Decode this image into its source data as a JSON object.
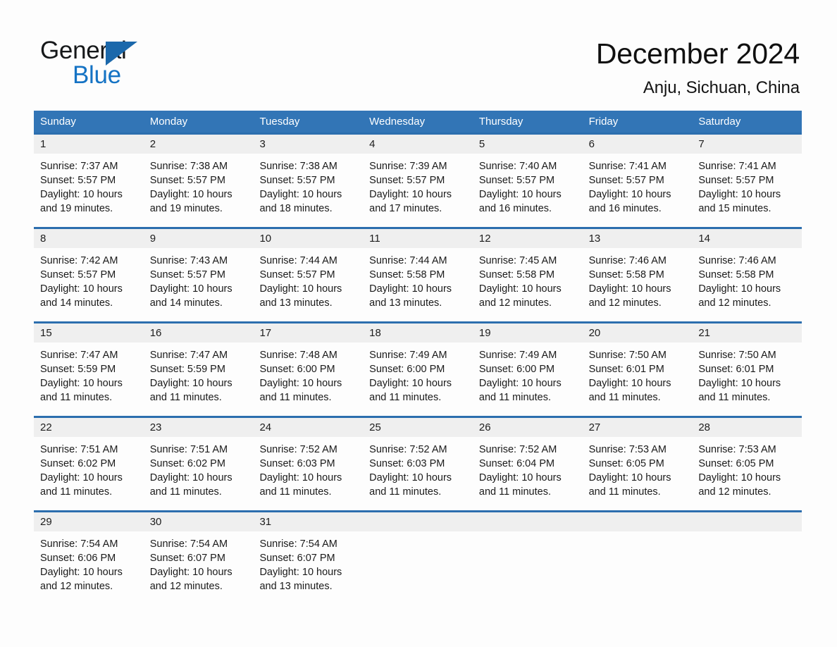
{
  "brand": {
    "logo_text_top": "General",
    "logo_text_bottom": "Blue",
    "logo_black": "#16181a",
    "logo_blue": "#1573c4",
    "triangle_blue": "#1b68ab"
  },
  "header": {
    "title": "December 2024",
    "subtitle": "Anju, Sichuan, China"
  },
  "theme": {
    "header_band": "#3275b6",
    "week_rule": "#2c6eae",
    "daynum_band": "#efefef",
    "page_bg": "#fdfdfd",
    "text": "#1a1a1a"
  },
  "weekdays": [
    "Sunday",
    "Monday",
    "Tuesday",
    "Wednesday",
    "Thursday",
    "Friday",
    "Saturday"
  ],
  "weeks": [
    [
      {
        "day": "1",
        "sunrise": "Sunrise: 7:37 AM",
        "sunset": "Sunset: 5:57 PM",
        "daylight": "Daylight: 10 hours and 19 minutes."
      },
      {
        "day": "2",
        "sunrise": "Sunrise: 7:38 AM",
        "sunset": "Sunset: 5:57 PM",
        "daylight": "Daylight: 10 hours and 19 minutes."
      },
      {
        "day": "3",
        "sunrise": "Sunrise: 7:38 AM",
        "sunset": "Sunset: 5:57 PM",
        "daylight": "Daylight: 10 hours and 18 minutes."
      },
      {
        "day": "4",
        "sunrise": "Sunrise: 7:39 AM",
        "sunset": "Sunset: 5:57 PM",
        "daylight": "Daylight: 10 hours and 17 minutes."
      },
      {
        "day": "5",
        "sunrise": "Sunrise: 7:40 AM",
        "sunset": "Sunset: 5:57 PM",
        "daylight": "Daylight: 10 hours and 16 minutes."
      },
      {
        "day": "6",
        "sunrise": "Sunrise: 7:41 AM",
        "sunset": "Sunset: 5:57 PM",
        "daylight": "Daylight: 10 hours and 16 minutes."
      },
      {
        "day": "7",
        "sunrise": "Sunrise: 7:41 AM",
        "sunset": "Sunset: 5:57 PM",
        "daylight": "Daylight: 10 hours and 15 minutes."
      }
    ],
    [
      {
        "day": "8",
        "sunrise": "Sunrise: 7:42 AM",
        "sunset": "Sunset: 5:57 PM",
        "daylight": "Daylight: 10 hours and 14 minutes."
      },
      {
        "day": "9",
        "sunrise": "Sunrise: 7:43 AM",
        "sunset": "Sunset: 5:57 PM",
        "daylight": "Daylight: 10 hours and 14 minutes."
      },
      {
        "day": "10",
        "sunrise": "Sunrise: 7:44 AM",
        "sunset": "Sunset: 5:57 PM",
        "daylight": "Daylight: 10 hours and 13 minutes."
      },
      {
        "day": "11",
        "sunrise": "Sunrise: 7:44 AM",
        "sunset": "Sunset: 5:58 PM",
        "daylight": "Daylight: 10 hours and 13 minutes."
      },
      {
        "day": "12",
        "sunrise": "Sunrise: 7:45 AM",
        "sunset": "Sunset: 5:58 PM",
        "daylight": "Daylight: 10 hours and 12 minutes."
      },
      {
        "day": "13",
        "sunrise": "Sunrise: 7:46 AM",
        "sunset": "Sunset: 5:58 PM",
        "daylight": "Daylight: 10 hours and 12 minutes."
      },
      {
        "day": "14",
        "sunrise": "Sunrise: 7:46 AM",
        "sunset": "Sunset: 5:58 PM",
        "daylight": "Daylight: 10 hours and 12 minutes."
      }
    ],
    [
      {
        "day": "15",
        "sunrise": "Sunrise: 7:47 AM",
        "sunset": "Sunset: 5:59 PM",
        "daylight": "Daylight: 10 hours and 11 minutes."
      },
      {
        "day": "16",
        "sunrise": "Sunrise: 7:47 AM",
        "sunset": "Sunset: 5:59 PM",
        "daylight": "Daylight: 10 hours and 11 minutes."
      },
      {
        "day": "17",
        "sunrise": "Sunrise: 7:48 AM",
        "sunset": "Sunset: 6:00 PM",
        "daylight": "Daylight: 10 hours and 11 minutes."
      },
      {
        "day": "18",
        "sunrise": "Sunrise: 7:49 AM",
        "sunset": "Sunset: 6:00 PM",
        "daylight": "Daylight: 10 hours and 11 minutes."
      },
      {
        "day": "19",
        "sunrise": "Sunrise: 7:49 AM",
        "sunset": "Sunset: 6:00 PM",
        "daylight": "Daylight: 10 hours and 11 minutes."
      },
      {
        "day": "20",
        "sunrise": "Sunrise: 7:50 AM",
        "sunset": "Sunset: 6:01 PM",
        "daylight": "Daylight: 10 hours and 11 minutes."
      },
      {
        "day": "21",
        "sunrise": "Sunrise: 7:50 AM",
        "sunset": "Sunset: 6:01 PM",
        "daylight": "Daylight: 10 hours and 11 minutes."
      }
    ],
    [
      {
        "day": "22",
        "sunrise": "Sunrise: 7:51 AM",
        "sunset": "Sunset: 6:02 PM",
        "daylight": "Daylight: 10 hours and 11 minutes."
      },
      {
        "day": "23",
        "sunrise": "Sunrise: 7:51 AM",
        "sunset": "Sunset: 6:02 PM",
        "daylight": "Daylight: 10 hours and 11 minutes."
      },
      {
        "day": "24",
        "sunrise": "Sunrise: 7:52 AM",
        "sunset": "Sunset: 6:03 PM",
        "daylight": "Daylight: 10 hours and 11 minutes."
      },
      {
        "day": "25",
        "sunrise": "Sunrise: 7:52 AM",
        "sunset": "Sunset: 6:03 PM",
        "daylight": "Daylight: 10 hours and 11 minutes."
      },
      {
        "day": "26",
        "sunrise": "Sunrise: 7:52 AM",
        "sunset": "Sunset: 6:04 PM",
        "daylight": "Daylight: 10 hours and 11 minutes."
      },
      {
        "day": "27",
        "sunrise": "Sunrise: 7:53 AM",
        "sunset": "Sunset: 6:05 PM",
        "daylight": "Daylight: 10 hours and 11 minutes."
      },
      {
        "day": "28",
        "sunrise": "Sunrise: 7:53 AM",
        "sunset": "Sunset: 6:05 PM",
        "daylight": "Daylight: 10 hours and 12 minutes."
      }
    ],
    [
      {
        "day": "29",
        "sunrise": "Sunrise: 7:54 AM",
        "sunset": "Sunset: 6:06 PM",
        "daylight": "Daylight: 10 hours and 12 minutes."
      },
      {
        "day": "30",
        "sunrise": "Sunrise: 7:54 AM",
        "sunset": "Sunset: 6:07 PM",
        "daylight": "Daylight: 10 hours and 12 minutes."
      },
      {
        "day": "31",
        "sunrise": "Sunrise: 7:54 AM",
        "sunset": "Sunset: 6:07 PM",
        "daylight": "Daylight: 10 hours and 13 minutes."
      },
      {
        "day": "",
        "sunrise": "",
        "sunset": "",
        "daylight": ""
      },
      {
        "day": "",
        "sunrise": "",
        "sunset": "",
        "daylight": ""
      },
      {
        "day": "",
        "sunrise": "",
        "sunset": "",
        "daylight": ""
      },
      {
        "day": "",
        "sunrise": "",
        "sunset": "",
        "daylight": ""
      }
    ]
  ]
}
